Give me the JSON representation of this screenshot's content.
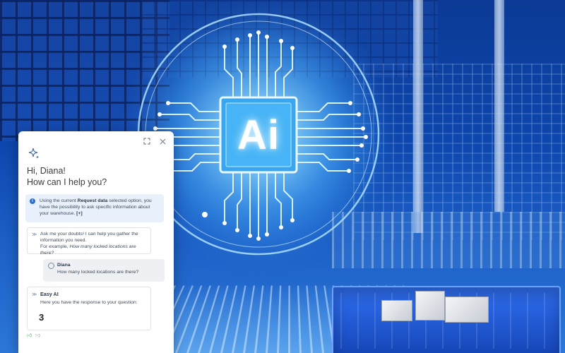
{
  "panel": {
    "greeting_line1": "Hi, Diana!",
    "greeting_line2": "How can I help you?",
    "info": {
      "text_before": "Using the current ",
      "bold": "Request data",
      "text_after": " selected option, you have the possibility to ask specific information about your warehouse.",
      "more": "[+]"
    },
    "ai_intro": {
      "line": "Ask me your doubts! I can help you gather the information you need.",
      "example_prefix": "For example, ",
      "example": "How many locked locations are there?"
    },
    "user_message": {
      "name": "Diana",
      "text": "How many locked locations are there?"
    },
    "ai_response": {
      "name": "Easy AI",
      "text": "Here you have the response to your question:",
      "answer": "3"
    },
    "icons": {
      "expand": "expand-icon",
      "close": "close-icon",
      "sparkle": "sparkle-icon",
      "info": "info-icon",
      "bot": "bot-icon",
      "user": "user-icon",
      "thumb_up": "thumbs-up-icon",
      "thumb_down": "thumbs-down-icon"
    }
  },
  "graphic": {
    "chip_label": "Ai"
  },
  "colors": {
    "accent": "#2b6fc9",
    "info_bg": "#e8f1fb",
    "thumb_up": "#2e9e3c",
    "chip_glow": "#7fd6ff"
  }
}
